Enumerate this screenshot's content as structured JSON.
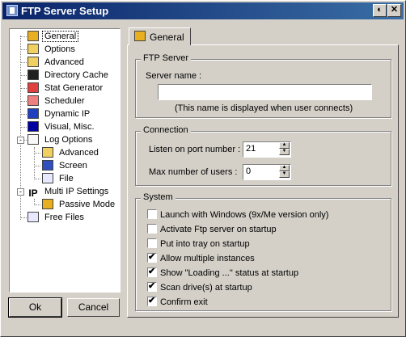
{
  "window": {
    "title": "FTP Server Setup"
  },
  "tree": {
    "items": [
      {
        "label": "General",
        "icon": "tools-icon"
      },
      {
        "label": "Options",
        "icon": "options-icon"
      },
      {
        "label": "Advanced",
        "icon": "advanced-icon"
      },
      {
        "label": "Directory Cache",
        "icon": "pencil-icon"
      },
      {
        "label": "Stat Generator",
        "icon": "stat-icon"
      },
      {
        "label": "Scheduler",
        "icon": "clock-icon"
      },
      {
        "label": "Dynamic IP",
        "icon": "ip-icon"
      },
      {
        "label": "Visual, Misc.",
        "icon": "monitor-icon"
      },
      {
        "label": "Log Options",
        "icon": "log-icon"
      },
      {
        "label": "Advanced",
        "icon": "advanced-log-icon"
      },
      {
        "label": "Screen",
        "icon": "screen-icon"
      },
      {
        "label": "File",
        "icon": "file-icon"
      },
      {
        "label": "Multi IP Settings",
        "icon": "ip-letters-icon"
      },
      {
        "label": "Passive Mode",
        "icon": "passive-icon"
      },
      {
        "label": "Free Files",
        "icon": "free-files-icon"
      }
    ]
  },
  "buttons": {
    "ok": "Ok",
    "cancel": "Cancel"
  },
  "tab": {
    "label": "General"
  },
  "ftp_server": {
    "title": "FTP Server",
    "server_name_label": "Server name :",
    "server_name_value": "",
    "hint": "(This name is displayed when user connects)"
  },
  "connection": {
    "title": "Connection",
    "port_label": "Listen on port number :",
    "port_value": "21",
    "max_users_label": "Max number of users :",
    "max_users_value": "0"
  },
  "system": {
    "title": "System",
    "options": [
      {
        "label": "Launch with Windows (9x/Me version only)",
        "checked": false
      },
      {
        "label": "Activate Ftp server on startup",
        "checked": false
      },
      {
        "label": "Put into tray on startup",
        "checked": false
      },
      {
        "label": "Allow multiple instances",
        "checked": true
      },
      {
        "label": "Show \"Loading ...\" status at startup",
        "checked": true
      },
      {
        "label": "Scan drive(s) at startup",
        "checked": true
      },
      {
        "label": "Confirm exit",
        "checked": true
      }
    ]
  }
}
